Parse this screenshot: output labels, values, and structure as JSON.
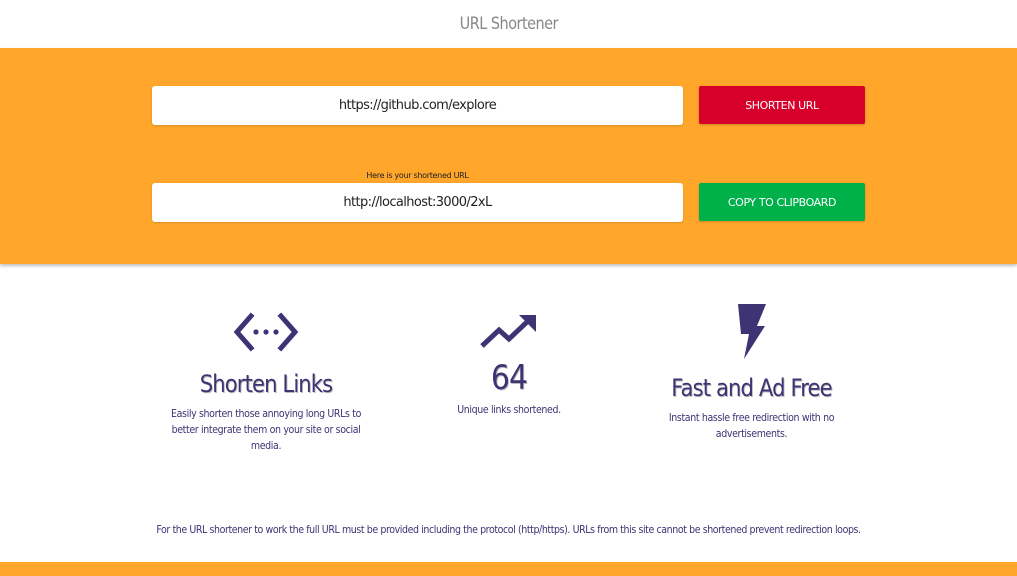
{
  "header": {
    "title": "URL Shortener"
  },
  "hero": {
    "url_input_value": "https://github.com/explore",
    "shorten_button_label": "SHORTEN URL",
    "result_hint": "Here is your shortened URL",
    "short_url_value": "http://localhost:3000/2xL",
    "copy_button_label": "COPY TO CLIPBOARD",
    "colors": {
      "background": "#ffa62b",
      "shorten": "#d6002a",
      "copy": "#00b14a"
    }
  },
  "features": {
    "shorten": {
      "icon": "code-arrows-icon",
      "title": "Shorten Links",
      "description": "Easily shorten those annoying long URLs to better integrate them on your site or social media."
    },
    "count": {
      "icon": "trending-up-icon",
      "value": "64",
      "description": "Unique links shortened."
    },
    "fast": {
      "icon": "lightning-bolt-icon",
      "title": "Fast and Ad Free",
      "description": "Instant hassle free redirection with no advertisements."
    }
  },
  "footer": {
    "note": "For the URL shortener to work the full URL must be provided including the protocol (http/https). URLs from this site cannot be shortened prevent redirection loops."
  }
}
